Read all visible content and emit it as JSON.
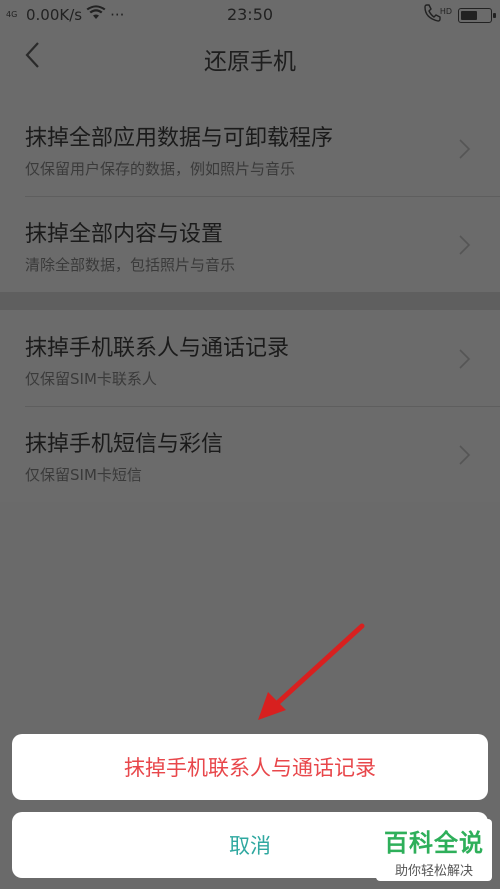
{
  "status_bar": {
    "signal_label": "4G",
    "speed": "0.00K/s",
    "dots": "···",
    "time": "23:50",
    "hd": "HD"
  },
  "header": {
    "title": "还原手机"
  },
  "groups": [
    {
      "items": [
        {
          "title": "抹掉全部应用数据与可卸载程序",
          "subtitle": "仅保留用户保存的数据，例如照片与音乐"
        },
        {
          "title": "抹掉全部内容与设置",
          "subtitle": "清除全部数据，包括照片与音乐"
        }
      ]
    },
    {
      "items": [
        {
          "title": "抹掉手机联系人与通话记录",
          "subtitle": "仅保留SIM卡联系人"
        },
        {
          "title": "抹掉手机短信与彩信",
          "subtitle": "仅保留SIM卡短信"
        }
      ]
    }
  ],
  "action_sheet": {
    "confirm_label": "抹掉手机联系人与通话记录",
    "cancel_label": "取消"
  },
  "watermark": {
    "title": "百科全说",
    "subtitle": "助你轻松解决"
  },
  "colors": {
    "confirm_text": "#e8474b",
    "cancel_text": "#2fa8a0",
    "overlay_bg": "#6a6a6a",
    "annotation_arrow": "#d8201f"
  },
  "battery_level": 0.6
}
